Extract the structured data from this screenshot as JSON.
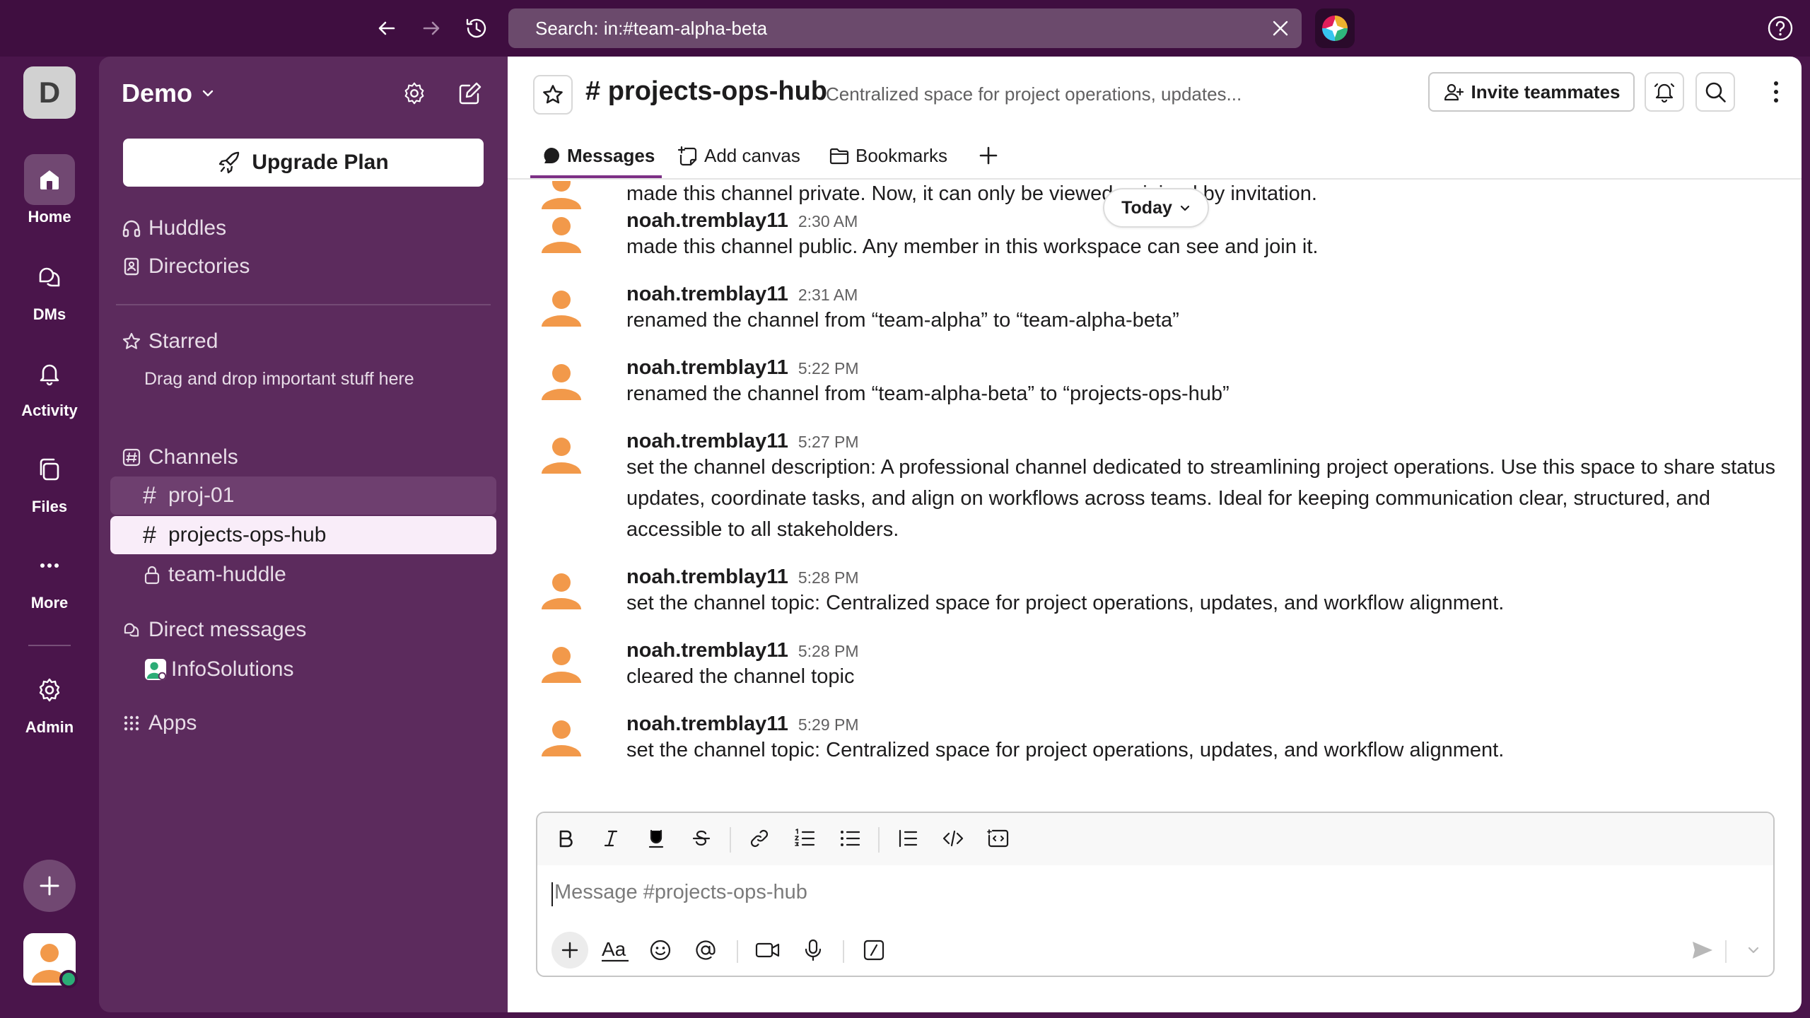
{
  "topbar": {
    "search_text": "Search: in:#team-alpha-beta"
  },
  "rail": {
    "workspace_initial": "D",
    "items": [
      {
        "label": "Home"
      },
      {
        "label": "DMs"
      },
      {
        "label": "Activity"
      },
      {
        "label": "Files"
      },
      {
        "label": "More"
      },
      {
        "label": "Admin"
      }
    ]
  },
  "sidebar": {
    "workspace_name": "Demo",
    "upgrade_label": "Upgrade Plan",
    "huddles": "Huddles",
    "directories": "Directories",
    "starred": "Starred",
    "starred_hint": "Drag and drop important stuff here",
    "channels_header": "Channels",
    "channels": [
      {
        "name": "proj-01",
        "prefix": "#"
      },
      {
        "name": "projects-ops-hub",
        "prefix": "#"
      },
      {
        "name": "team-huddle",
        "prefix": "lock"
      }
    ],
    "dm_header": "Direct messages",
    "dms": [
      {
        "name": "InfoSolutions"
      }
    ],
    "apps": "Apps"
  },
  "channel": {
    "title": "# projects-ops-hub",
    "topic": "Centralized space for project operations, updates...",
    "invite_label": "Invite teammates",
    "tabs": [
      {
        "label": "Messages"
      },
      {
        "label": "Add canvas"
      },
      {
        "label": "Bookmarks"
      }
    ],
    "today_label": "Today"
  },
  "messages": [
    {
      "author": "",
      "time": "",
      "text": "made this channel private. Now, it can only be viewed or joined by invitation."
    },
    {
      "author": "noah.tremblay11",
      "time": "2:30 AM",
      "text": "made this channel public. Any member in this workspace can see and join it."
    },
    {
      "author": "noah.tremblay11",
      "time": "2:31 AM",
      "text": "renamed the channel from “team-alpha” to “team-alpha-beta”"
    },
    {
      "author": "noah.tremblay11",
      "time": "5:22 PM",
      "text": "renamed the channel from “team-alpha-beta” to “projects-ops-hub”"
    },
    {
      "author": "noah.tremblay11",
      "time": "5:27 PM",
      "text": "set the channel description: A professional channel dedicated to streamlining project operations. Use this space to share status updates, coordinate tasks, and align on workflows across teams. Ideal for keeping communication clear, structured, and accessible to all stakeholders."
    },
    {
      "author": "noah.tremblay11",
      "time": "5:28 PM",
      "text": "set the channel topic: Centralized space for project operations, updates, and workflow alignment."
    },
    {
      "author": "noah.tremblay11",
      "time": "5:28 PM",
      "text": "cleared the channel topic"
    },
    {
      "author": "noah.tremblay11",
      "time": "5:29 PM",
      "text": "set the channel topic: Centralized space for project operations, updates, and workflow alignment."
    }
  ],
  "composer": {
    "placeholder": "Message #projects-ops-hub"
  },
  "colors": {
    "aubergine": "#3f0e40",
    "sidebar": "#5c2b5d",
    "selected_channel": "#f9edf9",
    "avatar_orange": "#f2994a",
    "presence": "#2bac76"
  }
}
